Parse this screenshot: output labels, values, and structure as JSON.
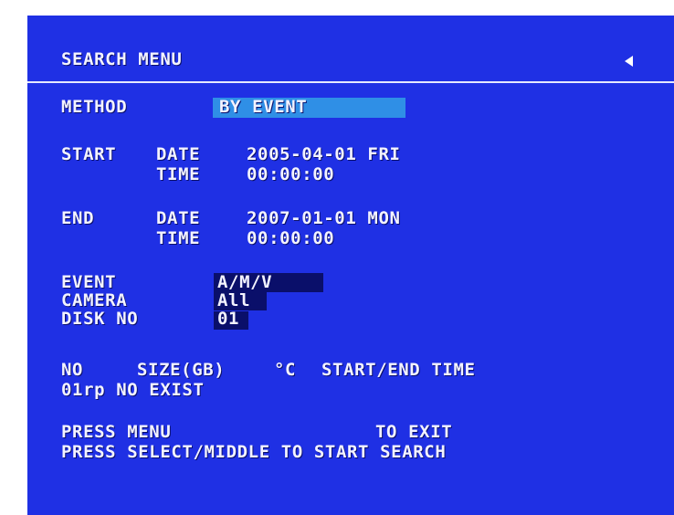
{
  "header": {
    "title": "SEARCH MENU",
    "back_icon": "left-triangle-icon"
  },
  "method": {
    "label": "METHOD",
    "value": "BY EVENT"
  },
  "start": {
    "label": "START",
    "date_label": "DATE",
    "date_value": "2005-04-01 FRI",
    "time_label": "TIME",
    "time_value": "00:00:00"
  },
  "end": {
    "label": "END",
    "date_label": "DATE",
    "date_value": "2007-01-01 MON",
    "time_label": "TIME",
    "time_value": "00:00:00"
  },
  "event": {
    "label": "EVENT",
    "value": "A/M/V"
  },
  "camera": {
    "label": "CAMERA",
    "value": "All"
  },
  "disk": {
    "label": "DISK NO",
    "value": "01"
  },
  "table": {
    "col_no": "NO",
    "col_size": "SIZE(GB)",
    "col_temp": "°C",
    "col_time": "START/END TIME",
    "row1": "01rp NO EXIST"
  },
  "footer": {
    "line1_left": "PRESS MENU",
    "line1_right": "TO EXIT",
    "line2": "PRESS SELECT/MIDDLE TO START SEARCH"
  },
  "colors": {
    "background": "#1f30e4",
    "highlight": "#2f8fe6",
    "dark_highlight": "#0a0f6a",
    "text": "#f3f3ff"
  }
}
